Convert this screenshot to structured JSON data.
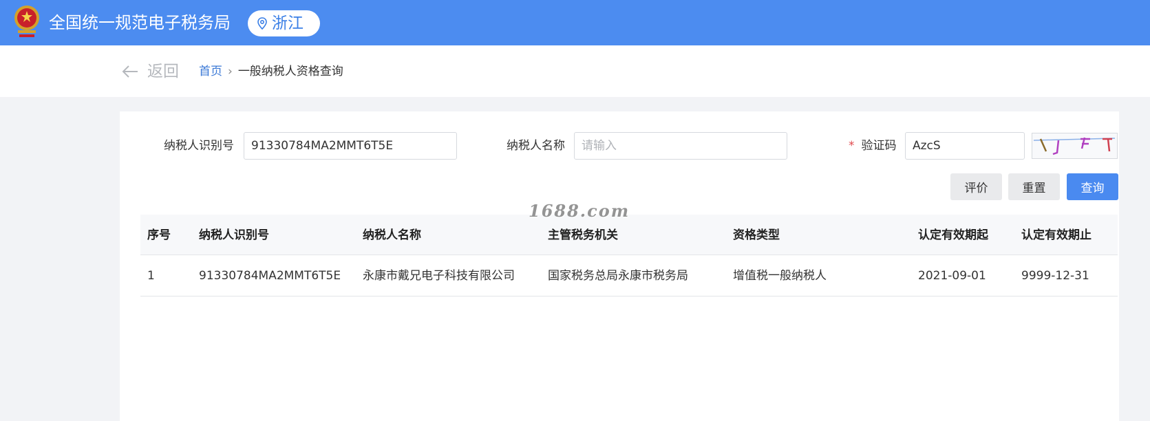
{
  "header": {
    "site_title": "全国统一规范电子税务局",
    "region": "浙江",
    "emblem_icon": "national-emblem-icon",
    "location_icon": "location-pin-icon",
    "bg_color": "#4c8cf0"
  },
  "nav": {
    "back_label": "返回",
    "back_icon": "arrow-left-icon",
    "breadcrumb": {
      "home": "首页",
      "separator": "›",
      "current": "一般纳税人资格查询"
    }
  },
  "form": {
    "taxpayer_id": {
      "label": "纳税人识别号",
      "value": "91330784MA2MMT6T5E",
      "placeholder": ""
    },
    "taxpayer_name": {
      "label": "纳税人名称",
      "value": "",
      "placeholder": "请输入"
    },
    "captcha": {
      "required_mark": "*",
      "label": "验证码",
      "value": "AzcS",
      "image_icon": "captcha-image"
    }
  },
  "buttons": {
    "evaluate": "评价",
    "reset": "重置",
    "query": "查询"
  },
  "table": {
    "columns": [
      "序号",
      "纳税人识别号",
      "纳税人名称",
      "主管税务机关",
      "资格类型",
      "认定有效期起",
      "认定有效期止"
    ],
    "rows": [
      [
        "1",
        "91330784MA2MMT6T5E",
        "永康市戴兄电子科技有限公司",
        "国家税务总局永康市税务局",
        "增值税一般纳税人",
        "2021-09-01",
        "9999-12-31"
      ]
    ]
  },
  "watermark": "1688.com",
  "colors": {
    "primary": "#4a8af0",
    "link": "#3a78d6",
    "required": "#e0484d"
  }
}
